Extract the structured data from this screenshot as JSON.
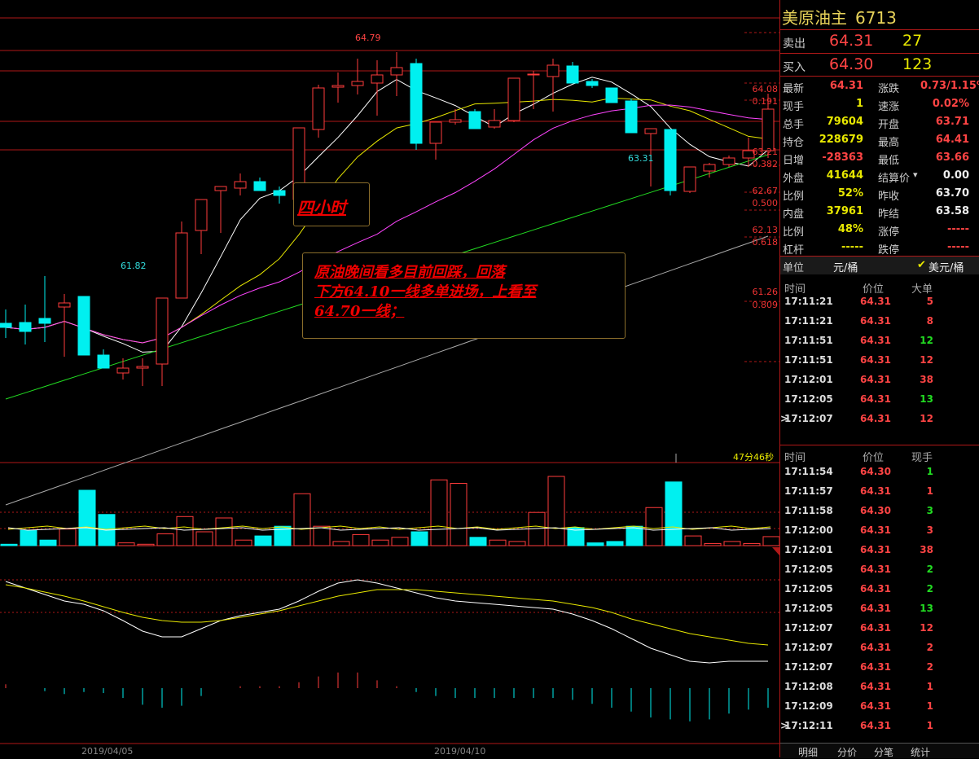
{
  "chart": {
    "high_label": "64.79",
    "low_label": "61.82",
    "recent_low_label": "63.31",
    "fib_levels": [
      {
        "price": "64.08",
        "ratio": "0.191"
      },
      {
        "price": "63.21",
        "ratio": "0.382"
      },
      {
        "price": "62.67",
        "ratio": "0.500"
      },
      {
        "price": "62.13",
        "ratio": "0.618"
      },
      {
        "price": "61.26",
        "ratio": "0.809"
      }
    ],
    "period_note": "四小时",
    "comment_lines": [
      "原油晚间看多目前回踩，回落",
      "下方64.10一线多单进场，上看至",
      "64.70一线；"
    ],
    "timer": "47分46秒",
    "dates": [
      "2019/04/05",
      "2019/04/10"
    ],
    "colors": {
      "up": "#ff3b3b",
      "down": "#00f0f0",
      "ma5": "#ffffff",
      "ma10": "#e8e800",
      "ma20": "#ff44ff",
      "ma60": "#22dd22",
      "ma120": "#aaaaaa",
      "grid": "#b01818"
    }
  },
  "chart_data": {
    "type": "candlestick",
    "candles": [
      {
        "o": 61.93,
        "h": 62.1,
        "l": 61.75,
        "c": 61.88
      },
      {
        "o": 61.94,
        "h": 62.16,
        "l": 61.67,
        "c": 61.83
      },
      {
        "o": 61.99,
        "h": 62.51,
        "l": 61.7,
        "c": 61.93
      },
      {
        "o": 62.13,
        "h": 62.29,
        "l": 61.52,
        "c": 62.18
      },
      {
        "o": 62.26,
        "h": 62.26,
        "l": 61.65,
        "c": 61.54
      },
      {
        "o": 61.54,
        "h": 61.61,
        "l": 61.38,
        "c": 61.38
      },
      {
        "o": 61.32,
        "h": 61.5,
        "l": 61.24,
        "c": 61.38
      },
      {
        "o": 61.38,
        "h": 61.5,
        "l": 61.16,
        "c": 61.4
      },
      {
        "o": 61.43,
        "h": 62.24,
        "l": 61.16,
        "c": 62.24
      },
      {
        "o": 62.24,
        "h": 63.18,
        "l": 62.24,
        "c": 63.04
      },
      {
        "o": 63.07,
        "h": 63.4,
        "l": 62.78,
        "c": 63.45
      },
      {
        "o": 63.56,
        "h": 63.56,
        "l": 63.04,
        "c": 63.61
      },
      {
        "o": 63.59,
        "h": 63.77,
        "l": 63.5,
        "c": 63.67
      },
      {
        "o": 63.67,
        "h": 63.72,
        "l": 63.56,
        "c": 63.56
      },
      {
        "o": 63.56,
        "h": 63.61,
        "l": 63.4,
        "c": 63.5
      },
      {
        "o": 63.45,
        "h": 64.33,
        "l": 63.34,
        "c": 64.33
      },
      {
        "o": 64.31,
        "h": 64.86,
        "l": 64.21,
        "c": 64.82
      },
      {
        "o": 64.83,
        "h": 65.01,
        "l": 64.64,
        "c": 64.85
      },
      {
        "o": 64.85,
        "h": 65.18,
        "l": 64.74,
        "c": 64.9
      },
      {
        "o": 64.88,
        "h": 65.16,
        "l": 64.48,
        "c": 64.98
      },
      {
        "o": 64.98,
        "h": 65.26,
        "l": 64.72,
        "c": 65.07
      },
      {
        "o": 65.12,
        "h": 65.18,
        "l": 64.06,
        "c": 64.14
      },
      {
        "o": 64.14,
        "h": 64.4,
        "l": 63.94,
        "c": 64.4
      },
      {
        "o": 64.4,
        "h": 64.56,
        "l": 64.37,
        "c": 64.43
      },
      {
        "o": 64.53,
        "h": 64.56,
        "l": 64.32,
        "c": 64.32
      },
      {
        "o": 64.34,
        "h": 64.56,
        "l": 64.32,
        "c": 64.42
      },
      {
        "o": 64.42,
        "h": 64.94,
        "l": 64.4,
        "c": 64.94
      },
      {
        "o": 64.99,
        "h": 65.03,
        "l": 64.56,
        "c": 64.99
      },
      {
        "o": 64.96,
        "h": 65.18,
        "l": 64.53,
        "c": 65.1
      },
      {
        "o": 65.09,
        "h": 65.14,
        "l": 64.88,
        "c": 64.88
      },
      {
        "o": 64.9,
        "h": 64.93,
        "l": 64.82,
        "c": 64.85
      },
      {
        "o": 64.82,
        "h": 64.82,
        "l": 64.64,
        "c": 64.64
      },
      {
        "o": 64.66,
        "h": 64.69,
        "l": 64.27,
        "c": 64.27
      },
      {
        "o": 64.26,
        "h": 64.32,
        "l": 63.61,
        "c": 64.32
      },
      {
        "o": 64.31,
        "h": 64.31,
        "l": 63.5,
        "c": 63.56
      },
      {
        "o": 63.55,
        "h": 63.85,
        "l": 63.53,
        "c": 63.85
      },
      {
        "o": 63.8,
        "h": 63.9,
        "l": 63.72,
        "c": 63.88
      },
      {
        "o": 63.88,
        "h": 63.99,
        "l": 63.85,
        "c": 63.96
      },
      {
        "o": 63.96,
        "h": 64.21,
        "l": 63.85,
        "c": 64.05
      },
      {
        "o": 64.05,
        "h": 64.75,
        "l": 63.96,
        "c": 64.56
      }
    ],
    "volumes": [
      2,
      22,
      8,
      24,
      80,
      45,
      4,
      2,
      17,
      42,
      20,
      40,
      8,
      14,
      28,
      75,
      28,
      6,
      16,
      8,
      12,
      20,
      95,
      90,
      12,
      8,
      6,
      48,
      100,
      26,
      4,
      6,
      28,
      55,
      92,
      14,
      3,
      6,
      3,
      13
    ],
    "ylim": [
      60.5,
      65.6
    ]
  },
  "panel": {
    "name": "美原油主",
    "code": "6713",
    "sell": {
      "label": "卖出",
      "price": "64.31",
      "vol": "27"
    },
    "buy": {
      "label": "买入",
      "price": "64.30",
      "vol": "123"
    },
    "quotes": [
      {
        "l1": "最新",
        "v1": "64.31",
        "c1": "red",
        "l2": "涨跌",
        "v2": "0.73/1.15%",
        "c2": "red"
      },
      {
        "l1": "现手",
        "v1": "1",
        "c1": "yel",
        "l2": "速涨",
        "v2": "0.02%",
        "c2": "red"
      },
      {
        "l1": "总手",
        "v1": "79604",
        "c1": "yel",
        "l2": "开盘",
        "v2": "63.71",
        "c2": "red"
      },
      {
        "l1": "持仓",
        "v1": "228679",
        "c1": "yel",
        "l2": "最高",
        "v2": "64.41",
        "c2": "red"
      },
      {
        "l1": "日增",
        "v1": "-28363",
        "c1": "red",
        "l2": "最低",
        "v2": "63.66",
        "c2": "red"
      },
      {
        "l1": "外盘",
        "v1": "41644",
        "c1": "yel",
        "l2": "结算价",
        "v2": "0.00",
        "c2": "wht"
      },
      {
        "l1": "比例",
        "v1": "52%",
        "c1": "yel",
        "l2": "昨收",
        "v2": "63.70",
        "c2": "wht"
      },
      {
        "l1": "内盘",
        "v1": "37961",
        "c1": "yel",
        "l2": "昨结",
        "v2": "63.58",
        "c2": "wht"
      },
      {
        "l1": "比例",
        "v1": "48%",
        "c1": "yel",
        "l2": "涨停",
        "v2": "-----",
        "c2": "red"
      },
      {
        "l1": "杠杆",
        "v1": "-----",
        "c1": "yel",
        "l2": "跌停",
        "v2": "-----",
        "c2": "red"
      }
    ],
    "unit": {
      "label": "单位",
      "opt1": "元/桶",
      "opt2": "美元/桶",
      "check": "✔"
    },
    "t1_head": {
      "time": "时间",
      "price": "价位",
      "col3": "大单"
    },
    "t1_rows": [
      {
        "t": "17:11:21",
        "p": "64.31",
        "v": "5",
        "vc": "red"
      },
      {
        "t": "17:11:21",
        "p": "64.31",
        "v": "8",
        "vc": "red"
      },
      {
        "t": "17:11:51",
        "p": "64.31",
        "v": "12",
        "vc": "grn"
      },
      {
        "t": "17:11:51",
        "p": "64.31",
        "v": "12",
        "vc": "red"
      },
      {
        "t": "17:12:01",
        "p": "64.31",
        "v": "38",
        "vc": "red"
      },
      {
        "t": "17:12:05",
        "p": "64.31",
        "v": "13",
        "vc": "grn"
      },
      {
        "t": "17:12:07",
        "p": "64.31",
        "v": "12",
        "vc": "red"
      }
    ],
    "t2_head": {
      "time": "时间",
      "price": "价位",
      "col3": "现手"
    },
    "t2_rows": [
      {
        "t": "17:11:54",
        "p": "64.30",
        "v": "1",
        "vc": "grn"
      },
      {
        "t": "17:11:57",
        "p": "64.31",
        "v": "1",
        "vc": "red"
      },
      {
        "t": "17:11:58",
        "p": "64.30",
        "v": "3",
        "vc": "grn"
      },
      {
        "t": "17:12:00",
        "p": "64.31",
        "v": "3",
        "vc": "red"
      },
      {
        "t": "17:12:01",
        "p": "64.31",
        "v": "38",
        "vc": "red"
      },
      {
        "t": "17:12:05",
        "p": "64.31",
        "v": "2",
        "vc": "grn"
      },
      {
        "t": "17:12:05",
        "p": "64.31",
        "v": "2",
        "vc": "grn"
      },
      {
        "t": "17:12:05",
        "p": "64.31",
        "v": "13",
        "vc": "grn"
      },
      {
        "t": "17:12:07",
        "p": "64.31",
        "v": "12",
        "vc": "red"
      },
      {
        "t": "17:12:07",
        "p": "64.31",
        "v": "2",
        "vc": "red"
      },
      {
        "t": "17:12:07",
        "p": "64.31",
        "v": "2",
        "vc": "red"
      },
      {
        "t": "17:12:08",
        "p": "64.31",
        "v": "1",
        "vc": "red"
      },
      {
        "t": "17:12:09",
        "p": "64.31",
        "v": "1",
        "vc": "red"
      },
      {
        "t": "17:12:11",
        "p": "64.31",
        "v": "1",
        "vc": "red"
      }
    ],
    "tabs": [
      "明细",
      "分价",
      "分笔",
      "统计"
    ]
  }
}
